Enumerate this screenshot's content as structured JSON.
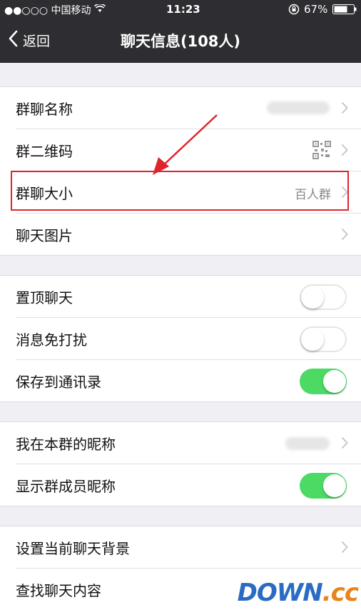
{
  "status_bar": {
    "carrier": "●●○○○ 中国移动",
    "time": "11:23",
    "battery": "67%"
  },
  "nav": {
    "back_label": "返回",
    "title": "聊天信息(108人)"
  },
  "group1": [
    {
      "label": "群聊名称"
    },
    {
      "label": "群二维码"
    },
    {
      "label": "群聊大小",
      "value": "百人群"
    },
    {
      "label": "聊天图片"
    }
  ],
  "group2": [
    {
      "label": "置顶聊天",
      "on": false
    },
    {
      "label": "消息免打扰",
      "on": false
    },
    {
      "label": "保存到通讯录",
      "on": true
    }
  ],
  "group3": [
    {
      "label": "我在本群的昵称"
    },
    {
      "label": "显示群成员昵称",
      "on": true
    }
  ],
  "group4": [
    {
      "label": "设置当前聊天背景"
    },
    {
      "label": "查找聊天内容"
    }
  ],
  "watermark": {
    "text": "DOWN",
    "suffix": ".cc"
  },
  "colors": {
    "nav_bg": "#2e2e32",
    "toggle_on": "#4cd964",
    "highlight": "#e0242c"
  }
}
